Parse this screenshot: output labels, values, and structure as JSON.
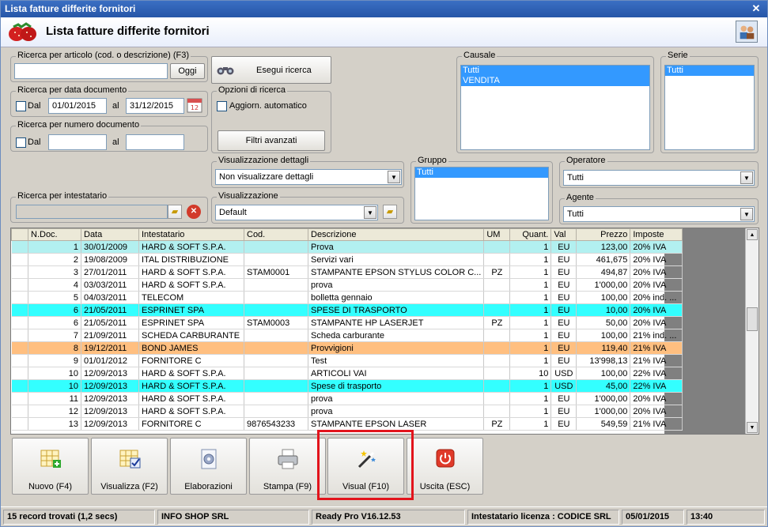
{
  "window": {
    "title": "Lista fatture differite fornitori"
  },
  "header": {
    "title": "Lista fatture differite fornitori"
  },
  "search_article": {
    "label": "Ricerca per articolo (cod. o descrizione) (F3)",
    "value": "",
    "button": "Oggi"
  },
  "search_date": {
    "label": "Ricerca per data documento",
    "dal_label": "Dal",
    "from": "01/01/2015",
    "al_label": "al",
    "to": "31/12/2015"
  },
  "search_number": {
    "label": "Ricerca per numero documento",
    "dal_label": "Dal",
    "from": "",
    "al_label": "al",
    "to": ""
  },
  "search_holder": {
    "label": "Ricerca per intestatario",
    "value": ""
  },
  "search_button": {
    "label": "Esegui ricerca"
  },
  "options": {
    "label": "Opzioni di ricerca",
    "auto_update": "Aggiorn. automatico",
    "advanced_filters": "Filtri avanzati"
  },
  "details_view": {
    "label": "Visualizzazione dettagli",
    "value": "Non visualizzare dettagli"
  },
  "view": {
    "label": "Visualizzazione",
    "value": "Default"
  },
  "causale": {
    "label": "Causale",
    "items": [
      "Tutti",
      "VENDITA"
    ]
  },
  "serie": {
    "label": "Serie",
    "items": [
      "Tutti"
    ]
  },
  "gruppo": {
    "label": "Gruppo",
    "items": [
      "Tutti"
    ]
  },
  "operatore": {
    "label": "Operatore",
    "value": "Tutti"
  },
  "agente": {
    "label": "Agente",
    "value": "Tutti"
  },
  "grid": {
    "columns": [
      "",
      "N.Doc.",
      "Data",
      "Intestatario",
      "Cod.",
      "Descrizione",
      "UM",
      "Quant.",
      "Val",
      "Prezzo",
      "Imposte"
    ],
    "rows": [
      {
        "style": "light",
        "cells": [
          "",
          "1",
          "30/01/2009",
          "HARD & SOFT S.P.A.",
          "",
          "Prova",
          "",
          "1",
          "EU",
          "123,00",
          "20% IVA"
        ]
      },
      {
        "style": "",
        "cells": [
          "",
          "2",
          "19/08/2009",
          "ITAL DISTRIBUZIONE",
          "",
          "Servizi vari",
          "",
          "1",
          "EU",
          "461,675",
          "20% IVA"
        ]
      },
      {
        "style": "",
        "cells": [
          "",
          "3",
          "27/01/2011",
          "HARD & SOFT S.P.A.",
          "STAM0001",
          "STAMPANTE EPSON STYLUS COLOR C...",
          "PZ",
          "1",
          "EU",
          "494,87",
          "20% IVA"
        ]
      },
      {
        "style": "",
        "cells": [
          "",
          "4",
          "03/03/2011",
          "HARD & SOFT S.P.A.",
          "",
          "prova",
          "",
          "1",
          "EU",
          "1'000,00",
          "20% IVA"
        ]
      },
      {
        "style": "",
        "cells": [
          "",
          "5",
          "04/03/2011",
          "TELECOM",
          "",
          "bolletta gennaio",
          "",
          "1",
          "EU",
          "100,00",
          "20% ind. ..."
        ]
      },
      {
        "style": "cyan",
        "cells": [
          "",
          "6",
          "21/05/2011",
          "ESPRINET SPA",
          "",
          "SPESE DI TRASPORTO",
          "",
          "1",
          "EU",
          "10,00",
          "20% IVA"
        ]
      },
      {
        "style": "",
        "cells": [
          "",
          "6",
          "21/05/2011",
          "ESPRINET SPA",
          "STAM0003",
          "STAMPANTE HP LASERJET",
          "PZ",
          "1",
          "EU",
          "50,00",
          "20% IVA"
        ]
      },
      {
        "style": "",
        "cells": [
          "",
          "7",
          "21/09/2011",
          "SCHEDA CARBURANTE",
          "",
          "Scheda carburante",
          "",
          "1",
          "EU",
          "100,00",
          "21% ind. ..."
        ]
      },
      {
        "style": "orange",
        "cells": [
          "",
          "8",
          "19/12/2011",
          "BOND JAMES",
          "",
          "Provvigioni",
          "",
          "1",
          "EU",
          "119,40",
          "21% IVA"
        ]
      },
      {
        "style": "",
        "cells": [
          "",
          "9",
          "01/01/2012",
          "FORNITORE C",
          "",
          "Test",
          "",
          "1",
          "EU",
          "13'998,13",
          "21% IVA"
        ]
      },
      {
        "style": "",
        "cells": [
          "",
          "10",
          "12/09/2013",
          "HARD & SOFT S.P.A.",
          "",
          "ARTICOLI VAI",
          "",
          "10",
          "USD",
          "100,00",
          "22% IVA"
        ]
      },
      {
        "style": "cyan",
        "cells": [
          "",
          "10",
          "12/09/2013",
          "HARD & SOFT S.P.A.",
          "",
          "Spese di trasporto",
          "",
          "1",
          "USD",
          "45,00",
          "22% IVA"
        ]
      },
      {
        "style": "",
        "cells": [
          "",
          "11",
          "12/09/2013",
          "HARD & SOFT S.P.A.",
          "",
          "prova",
          "",
          "1",
          "EU",
          "1'000,00",
          "20% IVA"
        ]
      },
      {
        "style": "",
        "cells": [
          "",
          "12",
          "12/09/2013",
          "HARD & SOFT S.P.A.",
          "",
          "prova",
          "",
          "1",
          "EU",
          "1'000,00",
          "20% IVA"
        ]
      },
      {
        "style": "",
        "cells": [
          "",
          "13",
          "12/09/2013",
          "FORNITORE C",
          "9876543233",
          "STAMPANTE EPSON LASER",
          "PZ",
          "1",
          "EU",
          "549,59",
          "21% IVA"
        ]
      }
    ]
  },
  "toolbar": [
    {
      "label": "Nuovo (F4)",
      "icon": "new-grid-icon"
    },
    {
      "label": "Visualizza (F2)",
      "icon": "view-grid-icon"
    },
    {
      "label": "Elaborazioni",
      "icon": "gear-document-icon"
    },
    {
      "label": "Stampa (F9)",
      "icon": "printer-icon"
    },
    {
      "label": "Visual (F10)",
      "icon": "magic-wand-icon"
    },
    {
      "label": "Uscita (ESC)",
      "icon": "power-icon"
    }
  ],
  "status": {
    "records": "15 record trovati (1,2 secs)",
    "company": "INFO SHOP SRL",
    "version": "Ready Pro V16.12.53",
    "license": "Intestatario licenza : CODICE SRL",
    "date": "05/01/2015",
    "time": "13:40"
  },
  "colors": {
    "title_bar": "#2656a8",
    "selection": "#3399ff",
    "row_cyan": "#33ffff",
    "row_light": "#b2f0f0",
    "row_orange": "#ffbf80",
    "highlight": "#e2141c"
  }
}
